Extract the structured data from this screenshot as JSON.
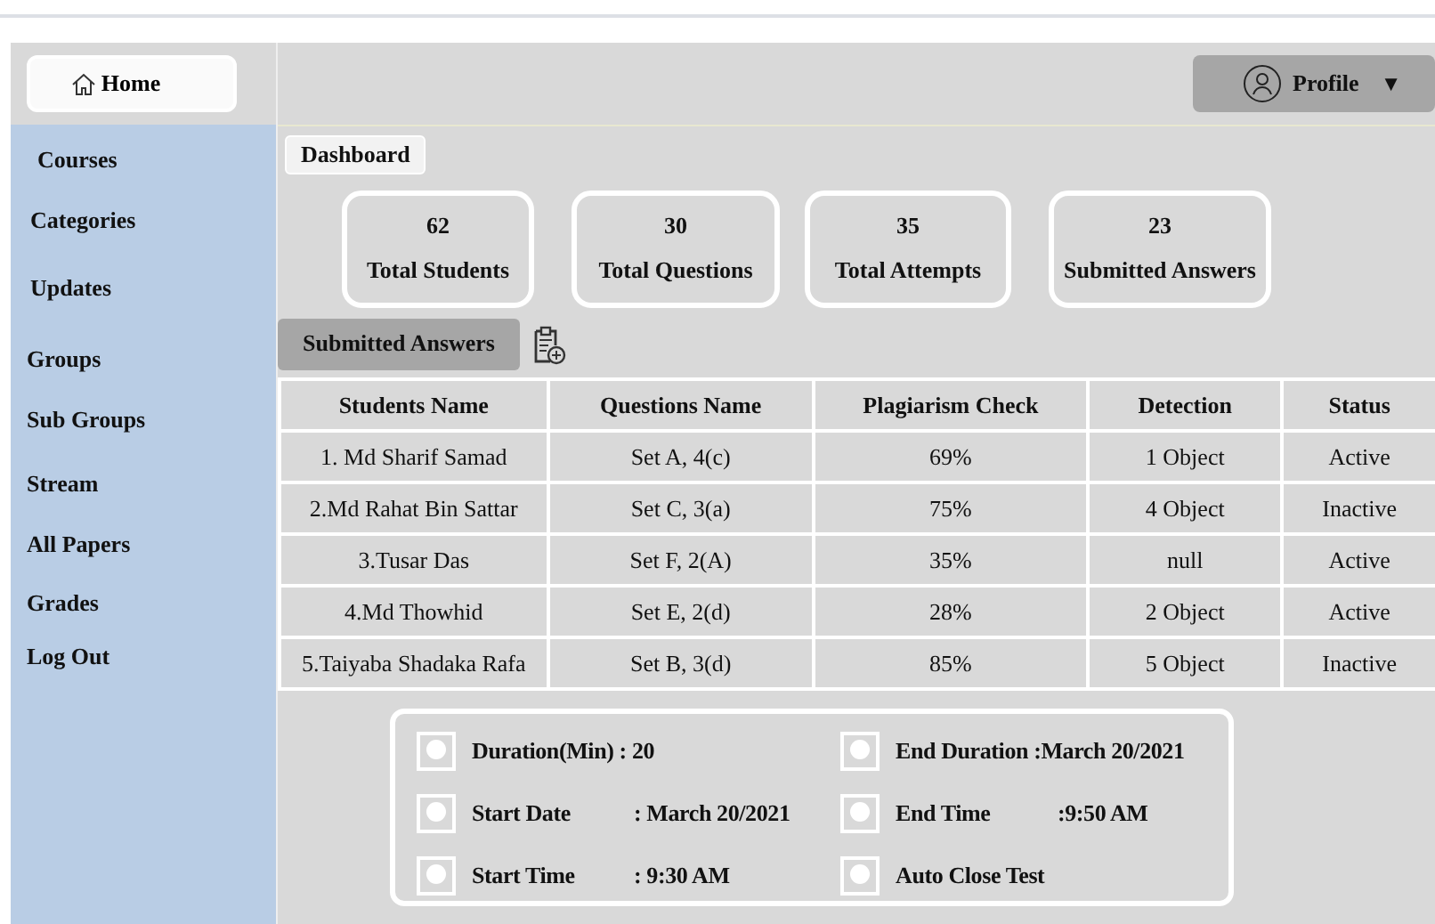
{
  "sidebar": {
    "home": {
      "label": "Home"
    },
    "items": [
      {
        "label": "Courses"
      },
      {
        "label": "Categories"
      },
      {
        "label": "Updates"
      },
      {
        "label": "Groups"
      },
      {
        "label": "Sub Groups"
      },
      {
        "label": "Stream"
      },
      {
        "label": "All Papers"
      },
      {
        "label": "Grades"
      },
      {
        "label": "Log Out"
      }
    ]
  },
  "header": {
    "profile": {
      "label": "Profile",
      "caret": "▼"
    }
  },
  "breadcrumb": "Dashboard",
  "stats": [
    {
      "value": "62",
      "label": "Total Students"
    },
    {
      "value": "30",
      "label": "Total Questions"
    },
    {
      "value": "35",
      "label": "Total Attempts"
    },
    {
      "value": "23",
      "label": "Submitted Answers"
    }
  ],
  "section": {
    "title": "Submitted Answers"
  },
  "table": {
    "columns": [
      "Students Name",
      "Questions Name",
      "Plagiarism Check",
      "Detection",
      "Status"
    ],
    "rows": [
      [
        "1. Md Sharif Samad",
        "Set A, 4(c)",
        "69%",
        "1 Object",
        "Active"
      ],
      [
        "2.Md Rahat Bin Sattar",
        "Set C,  3(a)",
        "75%",
        "4 Object",
        "Inactive"
      ],
      [
        "3.Tusar Das",
        "Set F,  2(A)",
        "35%",
        "null",
        "Active"
      ],
      [
        "4.Md Thowhid",
        "Set E, 2(d)",
        "28%",
        "2 Object",
        "Active"
      ],
      [
        "5.Taiyaba Shadaka Rafa",
        "Set B, 3(d)",
        "85%",
        "5 Object",
        "Inactive"
      ]
    ]
  },
  "settings": [
    {
      "label": "Duration(Min) : 20"
    },
    {
      "label": "End Duration :March 20/2021"
    },
    {
      "label": "Start Date",
      "value": ": March 20/2021"
    },
    {
      "label": "End Time",
      "value": ":9:50 AM"
    },
    {
      "label": "Start Time",
      "value": ":  9:30 AM"
    },
    {
      "label": "Auto Close Test"
    }
  ]
}
